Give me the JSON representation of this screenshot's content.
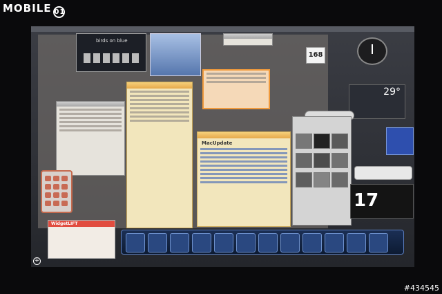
{
  "brand": {
    "text": "MOBILE",
    "ring": "01"
  },
  "birds_widget": {
    "text": "birds on blue"
  },
  "calendar_small": {
    "day": "168"
  },
  "calendar_big": {
    "day": "17"
  },
  "weather": {
    "temp": "29°"
  },
  "macupdate": {
    "title": "MacUpdate"
  },
  "widget_brand": {
    "text": "WidgetLIFT"
  },
  "icons": [
    "birds-icon",
    "apple-icon",
    "clock-icon"
  ],
  "colors": {
    "accent": "#f0a040",
    "screen": "#2e3036",
    "dock": "#1b2f55"
  },
  "watermark": {
    "text": "#434545"
  }
}
